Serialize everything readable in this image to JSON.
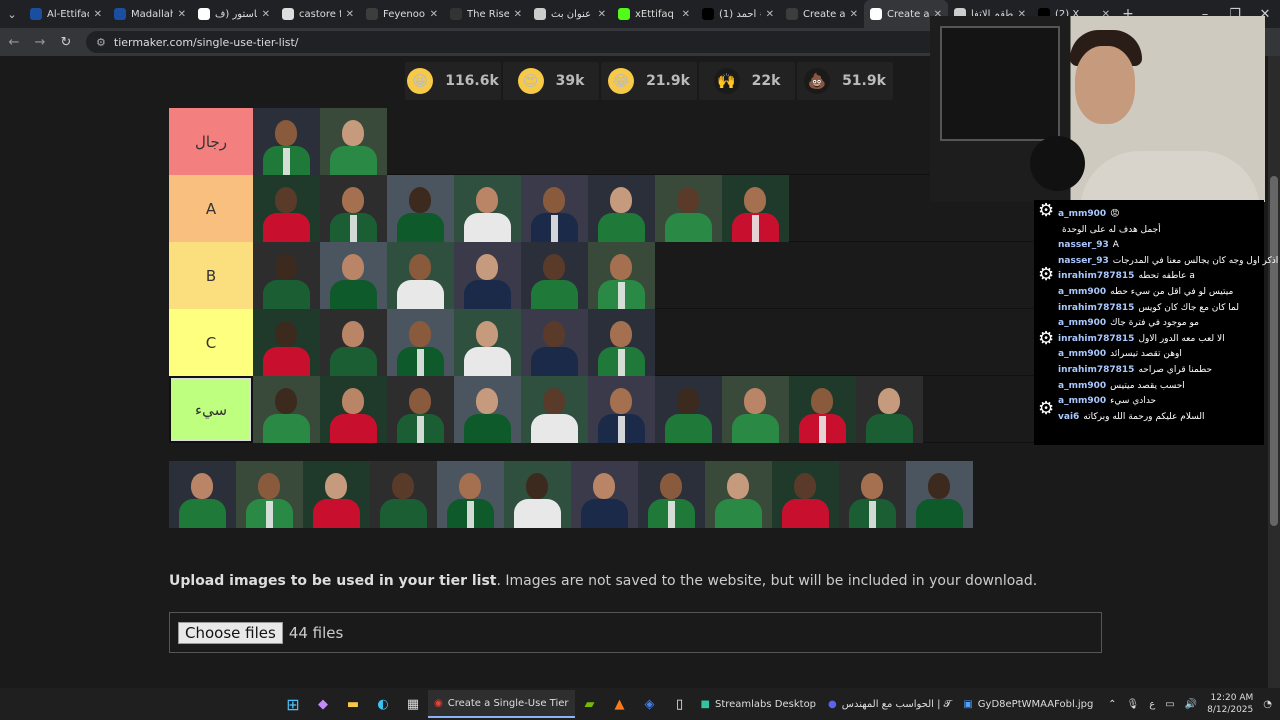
{
  "browser": {
    "tabs": [
      {
        "label": "Al-Ettifaq",
        "color": "#1a4fa0"
      },
      {
        "label": "Madallah",
        "color": "#1a4fa0"
      },
      {
        "label": "كاستور (ف",
        "color": "#ffffff"
      },
      {
        "label": "castore fo",
        "color": "#dddddd"
      },
      {
        "label": "Feyenoord",
        "color": "#3d3d3d"
      },
      {
        "label": "The Rise C",
        "color": "#333333"
      },
      {
        "label": "عنوان بث",
        "color": "#cccccc"
      },
      {
        "label": "xEttifaq St",
        "color": "#53fc18"
      },
      {
        "label": "(1) أحمد #",
        "color": "#000000"
      },
      {
        "label": "Create a N",
        "color": "#3d3d3d"
      },
      {
        "label": "Create a S",
        "color": "#ffffff",
        "active": true
      },
      {
        "label": "طقم الاتفا",
        "color": "#cccccc"
      },
      {
        "label": "(2) X",
        "color": "#000000"
      }
    ],
    "url": "tiermaker.com/single-use-tier-list/"
  },
  "reactions": [
    {
      "icon": "😀",
      "count": "116.6k",
      "bg": "#f7c948"
    },
    {
      "icon": "😍",
      "count": "39k",
      "bg": "#f7c948"
    },
    {
      "icon": "😂",
      "count": "21.9k",
      "bg": "#f7c948"
    },
    {
      "icon": "🙌",
      "count": "22k",
      "bg": "#1a1a1a"
    },
    {
      "icon": "💩",
      "count": "51.9k",
      "bg": "#1a1a1a"
    }
  ],
  "tiers": [
    {
      "label": "رجال",
      "color": "#f47f7f",
      "count": 2
    },
    {
      "label": "A",
      "color": "#f8bf7f",
      "count": 8
    },
    {
      "label": "B",
      "color": "#fbdf7f",
      "count": 6
    },
    {
      "label": "C",
      "color": "#feff7f",
      "count": 6
    },
    {
      "label": "سيء",
      "color": "#bfff7f",
      "count": 10,
      "selected": true
    }
  ],
  "pool_count": 12,
  "upload": {
    "bold": "Upload images to be used in your tier list",
    "rest": ". Images are not saved to the website, but will be included in your download.",
    "button": "Choose files",
    "files": "44 files"
  },
  "chat": [
    {
      "user": "a_mm900",
      "msg": "😡"
    },
    {
      "user": "",
      "msg": "أجمل هدف له على الوحدة"
    },
    {
      "user": "nasser_93",
      "msg": "A"
    },
    {
      "user": "nasser_93",
      "msg": "اذكر اول وجه كان يجالس معنا في المدرجات"
    },
    {
      "user": "inrahim787815",
      "msg": "عاطفه تحطه a"
    },
    {
      "user": "a_mm900",
      "msg": "ميتيس لو في اقل من سيء حطه"
    },
    {
      "user": "inrahim787815",
      "msg": "لما كان مع جاك كان كويس"
    },
    {
      "user": "a_mm900",
      "msg": "مو موجود في فترة جاك"
    },
    {
      "user": "inrahim787815",
      "msg": "الا لعب معه الدور الاول"
    },
    {
      "user": "a_mm900",
      "msg": "اوهن تقصد تيسرائد"
    },
    {
      "user": "inrahim787815",
      "msg": "حطمنا قراي صراحه"
    },
    {
      "user": "a_mm900",
      "msg": "احسب يقصد ميتيس"
    },
    {
      "user": "a_mm900",
      "msg": "حدادي سيء"
    },
    {
      "user": "vai6",
      "msg": "السلام عليكم ورحمة الله وبركاته"
    }
  ],
  "taskbar": {
    "apps": [
      {
        "label": "Create a Single-Use Tier",
        "active": true
      },
      {
        "label": "Streamlabs Desktop"
      },
      {
        "label": "الحواسب مع المهندس | 𝓣"
      },
      {
        "label": "GyD8ePtWMAAFobl.jpg"
      }
    ],
    "lang": "ع",
    "time": "12:20 AM",
    "date": "8/12/2025"
  }
}
